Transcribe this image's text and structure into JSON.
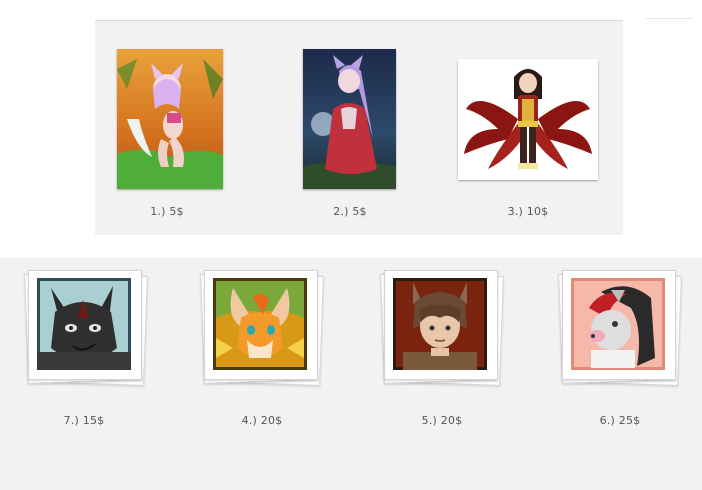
{
  "gallery_top": {
    "items": [
      {
        "caption": "1.) 5$",
        "icon": "anime-cat-girl-sunset-artwork"
      },
      {
        "caption": "2.) 5$",
        "icon": "anime-fox-girl-night-artwork"
      },
      {
        "caption": "3.) 10$",
        "icon": "nine-tailed-fox-character-artwork"
      }
    ]
  },
  "gallery_bottom": {
    "items": [
      {
        "caption": "7.) 15$",
        "icon": "black-wolf-icon-artwork"
      },
      {
        "caption": "4.) 20$",
        "icon": "orange-fox-icon-artwork"
      },
      {
        "caption": "5.) 20$",
        "icon": "brown-hair-boy-icon-artwork"
      },
      {
        "caption": "6.) 25$",
        "icon": "red-hair-creature-icon-artwork"
      }
    ]
  },
  "colors": {
    "panel_bg": "#f2f2f2",
    "caption_text": "#555555"
  }
}
